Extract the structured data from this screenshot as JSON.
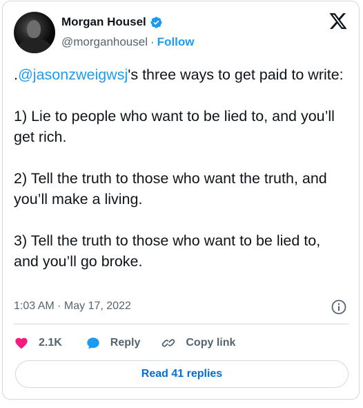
{
  "author": {
    "name": "Morgan Housel",
    "handle": "@morganhousel",
    "separator": "·",
    "follow_label": "Follow",
    "verified": true
  },
  "tweet": {
    "prefix": ".",
    "mention": "@jasonzweigwsj",
    "text_after_mention": "'s three ways to get paid to write:\n\n1) Lie to people who want to be lied to, and you’ll get rich.\n\n2) Tell the truth to those who want the truth, and you’ll make a living.\n\n3) Tell the truth to those who want to be lied to, and you’ll go broke.",
    "timestamp": "1:03 AM · May 17, 2022"
  },
  "actions": {
    "likes_count": "2.1K",
    "reply_label": "Reply",
    "copy_link_label": "Copy link"
  },
  "footer": {
    "read_replies_label": "Read 41 replies"
  },
  "colors": {
    "accent": "#1d9bf0",
    "like": "#f91880",
    "text_primary": "#0f1419",
    "text_secondary": "#536471",
    "border": "#cfd9de"
  },
  "icons": [
    "x-logo-icon",
    "verified-badge-icon",
    "info-icon",
    "heart-icon",
    "reply-bubble-icon",
    "link-icon"
  ]
}
